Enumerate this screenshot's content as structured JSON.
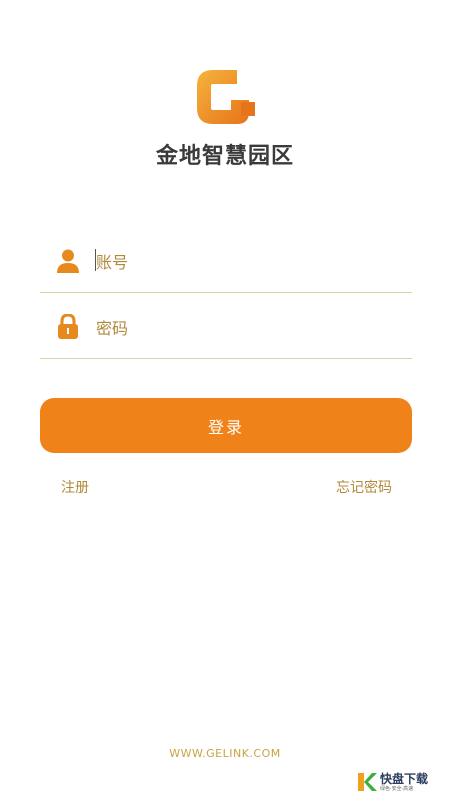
{
  "app": {
    "name": "金地智慧园区"
  },
  "login": {
    "account_placeholder": "账号",
    "password_placeholder": "密码",
    "submit_label": "登录",
    "register_label": "注册",
    "forgot_label": "忘记密码"
  },
  "footer": {
    "url": "WWW.GELINK.COM"
  },
  "watermark": {
    "brand": "快盘下载",
    "tagline": "绿色·安全·高速"
  },
  "colors": {
    "accent": "#ef8219",
    "gold": "#b08a3a",
    "divider": "#dcd2a8",
    "title": "#3a3a3a"
  },
  "icons": {
    "account": "user-icon",
    "password": "lock-icon",
    "logo": "g-logo-icon"
  }
}
